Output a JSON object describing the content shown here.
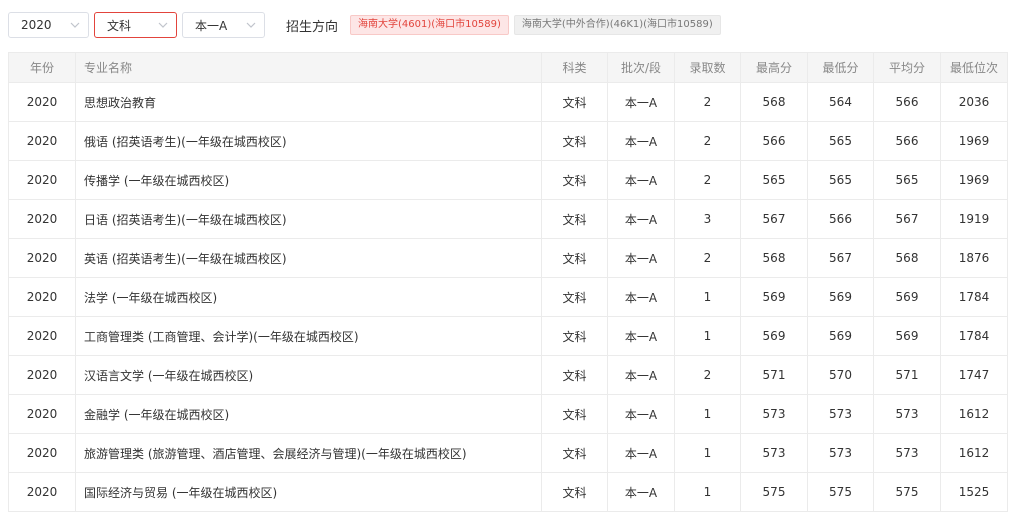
{
  "filters": {
    "year": "2020",
    "subject": "文科",
    "batch": "本一A",
    "direction_label": "招生方向",
    "tags": [
      {
        "label": "海南大学(4601)(海口市10589)",
        "active": true
      },
      {
        "label": "海南大学(中外合作)(46K1)(海口市10589)",
        "active": false
      }
    ]
  },
  "table": {
    "headers": [
      "年份",
      "专业名称",
      "科类",
      "批次/段",
      "录取数",
      "最高分",
      "最低分",
      "平均分",
      "最低位次"
    ],
    "rows": [
      [
        "2020",
        "思想政治教育",
        "文科",
        "本一A",
        "2",
        "568",
        "564",
        "566",
        "2036"
      ],
      [
        "2020",
        "俄语 (招英语考生)(一年级在城西校区)",
        "文科",
        "本一A",
        "2",
        "566",
        "565",
        "566",
        "1969"
      ],
      [
        "2020",
        "传播学 (一年级在城西校区)",
        "文科",
        "本一A",
        "2",
        "565",
        "565",
        "565",
        "1969"
      ],
      [
        "2020",
        "日语 (招英语考生)(一年级在城西校区)",
        "文科",
        "本一A",
        "3",
        "567",
        "566",
        "567",
        "1919"
      ],
      [
        "2020",
        "英语 (招英语考生)(一年级在城西校区)",
        "文科",
        "本一A",
        "2",
        "568",
        "567",
        "568",
        "1876"
      ],
      [
        "2020",
        "法学 (一年级在城西校区)",
        "文科",
        "本一A",
        "1",
        "569",
        "569",
        "569",
        "1784"
      ],
      [
        "2020",
        "工商管理类 (工商管理、会计学)(一年级在城西校区)",
        "文科",
        "本一A",
        "1",
        "569",
        "569",
        "569",
        "1784"
      ],
      [
        "2020",
        "汉语言文学 (一年级在城西校区)",
        "文科",
        "本一A",
        "2",
        "571",
        "570",
        "571",
        "1747"
      ],
      [
        "2020",
        "金融学 (一年级在城西校区)",
        "文科",
        "本一A",
        "1",
        "573",
        "573",
        "573",
        "1612"
      ],
      [
        "2020",
        "旅游管理类 (旅游管理、酒店管理、会展经济与管理)(一年级在城西校区)",
        "文科",
        "本一A",
        "1",
        "573",
        "573",
        "573",
        "1612"
      ],
      [
        "2020",
        "国际经济与贸易 (一年级在城西校区)",
        "文科",
        "本一A",
        "1",
        "575",
        "575",
        "575",
        "1525"
      ]
    ]
  },
  "colors": {
    "accent": "#e2443c",
    "header_bg": "#f5f5f5",
    "border": "#ebebeb"
  }
}
